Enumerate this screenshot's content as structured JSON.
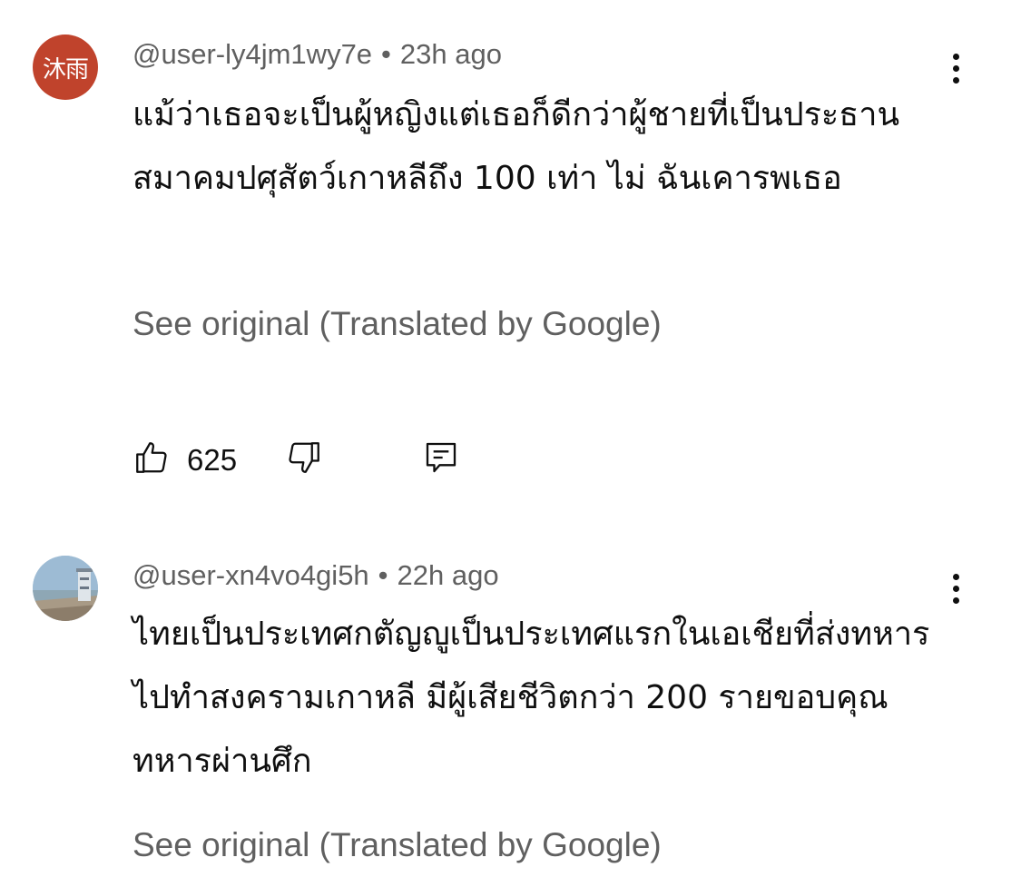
{
  "comments": [
    {
      "avatar_text": "沐雨",
      "avatar_color": "#c0432c",
      "handle": "@user-ly4jm1wy7e",
      "separator": "•",
      "time": "23h ago",
      "text": "แม้ว่าเธอจะเป็นผู้หญิงแต่เธอก็ดีกว่าผู้ชายที่เป็นประธานสมาคมปศุสัตว์เกาหลีถึง 100 เท่า ไม่ ฉันเคารพเธอ",
      "see_original": "See original (Translated by Google)",
      "like_count": "625"
    },
    {
      "avatar_text": "",
      "avatar_color": "#9db7cc",
      "handle": "@user-xn4vo4gi5h",
      "separator": "•",
      "time": "22h ago",
      "text": "ไทยเป็นประเทศกตัญญูเป็นประเทศแรกในเอเชียที่ส่งทหารไปทำสงครามเกาหลี มีผู้เสียชีวิตกว่า 200 รายขอบคุณทหารผ่านศึก",
      "see_original": "See original (Translated by Google)"
    }
  ],
  "icons": {
    "like": "thumbs-up-icon",
    "dislike": "thumbs-down-icon",
    "reply": "reply-icon",
    "more": "more-vertical-icon"
  }
}
